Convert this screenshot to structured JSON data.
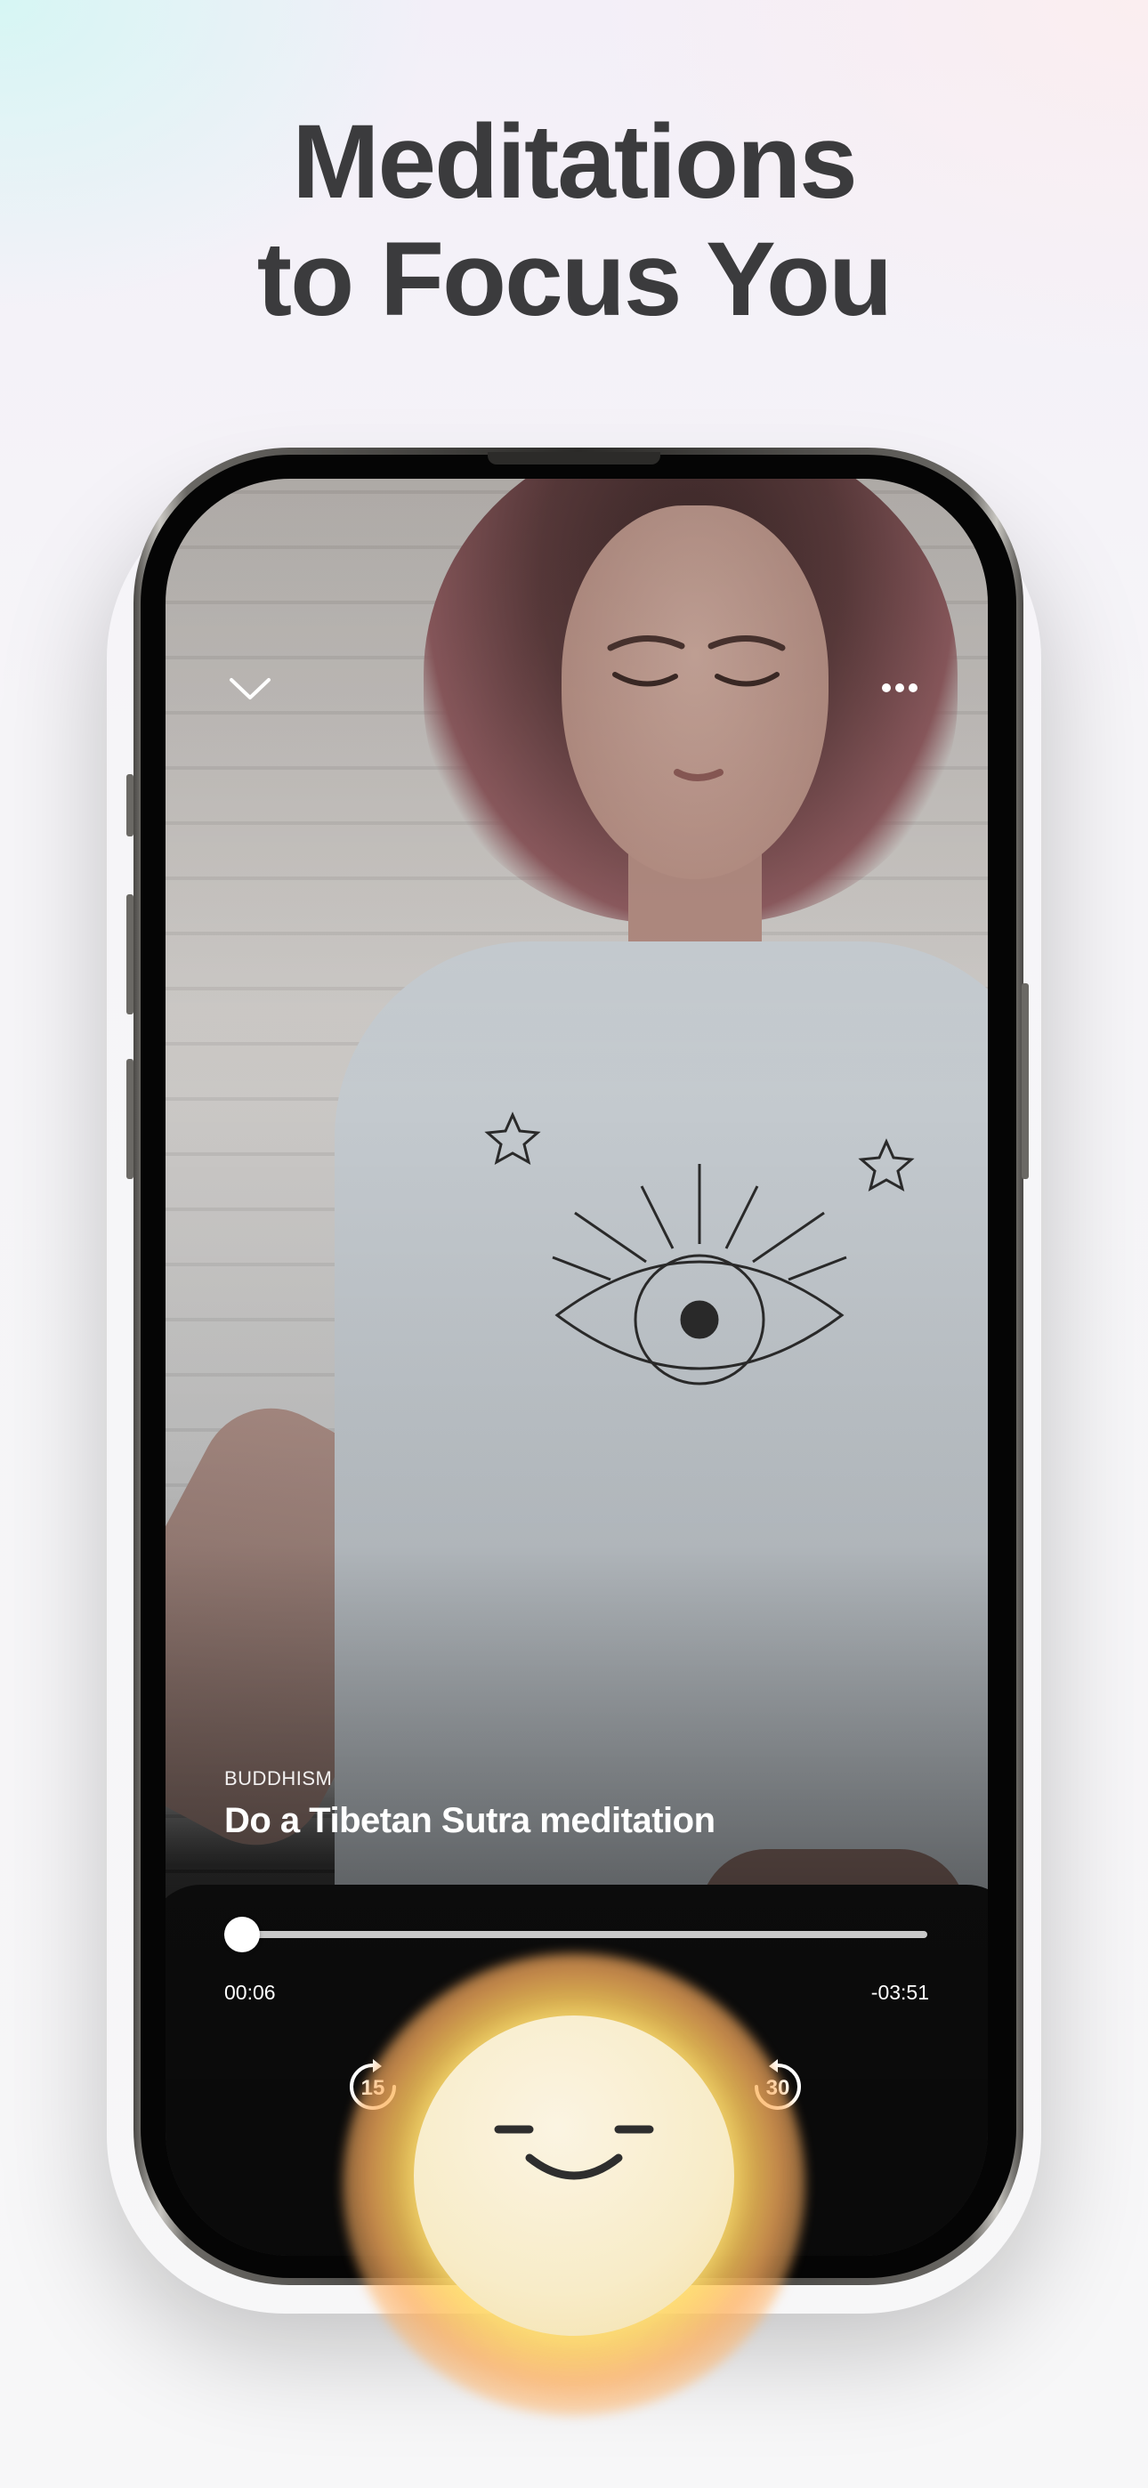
{
  "headline": {
    "line1": "Meditations",
    "line2": "to Focus You"
  },
  "player": {
    "category": "BUDDHISM",
    "title": "Do a Tibetan Sutra meditation",
    "elapsed": "00:06",
    "remaining": "-03:51",
    "progress_fraction": 0.025,
    "skip_back_seconds": "15",
    "skip_forward_seconds": "30"
  },
  "icons": {
    "collapse": "chevron-down-icon",
    "more": "more-horizontal-icon",
    "skip_back": "rewind-15-icon",
    "skip_forward": "forward-30-icon",
    "play": "smiling-face-icon"
  },
  "colors": {
    "headline": "#3b3b3d",
    "orb_core": "#f8ecc8",
    "orb_glow": "#ffd85c",
    "orb_edge": "#ffaf5f"
  }
}
